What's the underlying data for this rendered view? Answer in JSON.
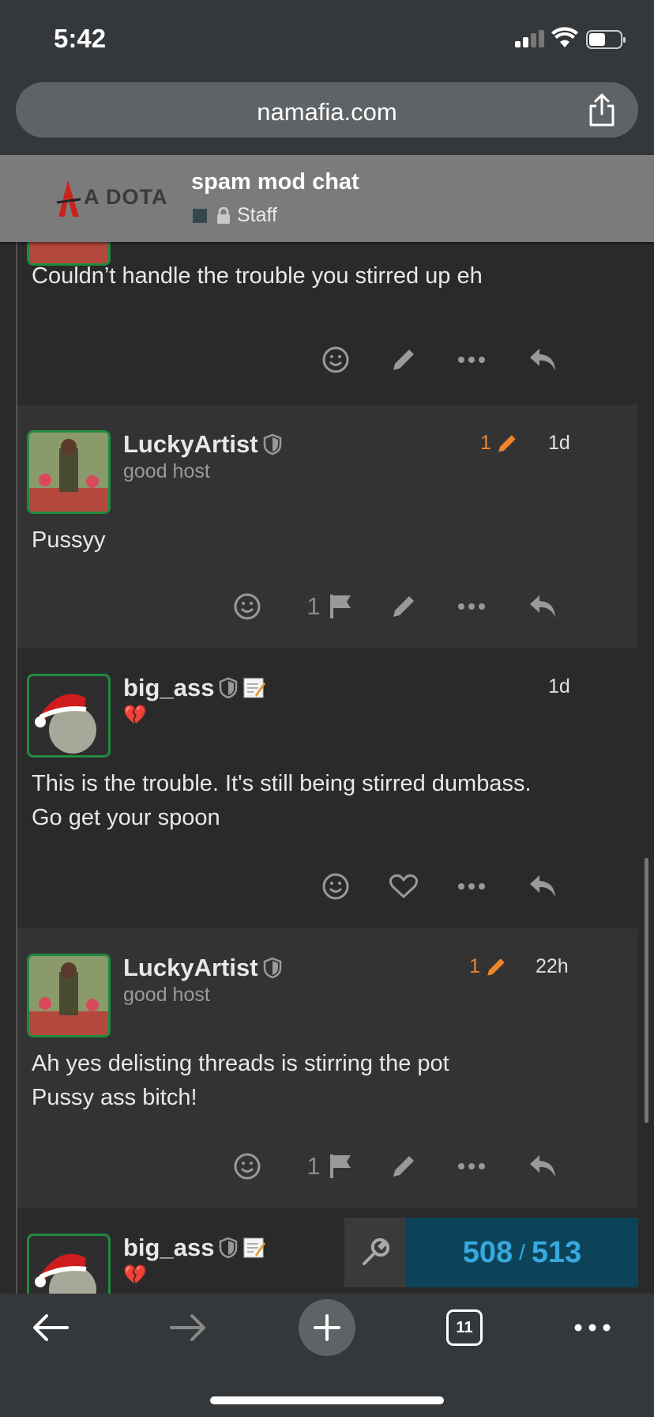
{
  "status": {
    "time": "5:42"
  },
  "browser": {
    "url": "namafia.com",
    "tab_count": "11"
  },
  "header": {
    "logo_text": "A DOTA",
    "topic_title": "spam mod chat",
    "category": "Staff"
  },
  "posts": [
    {
      "body_lines": [
        "Couldn’t handle the trouble you stirred up eh"
      ]
    },
    {
      "username": "LuckyArtist",
      "user_title": "good host",
      "edit_count": "1",
      "date": "1d",
      "body_lines": [
        "Pussyy"
      ],
      "flag_count": "1"
    },
    {
      "username": "big_ass",
      "flair": "💔",
      "date": "1d",
      "body_lines": [
        "This is the trouble. It's still being stirred dumbass.",
        "Go get your spoon"
      ]
    },
    {
      "username": "LuckyArtist",
      "user_title": "good host",
      "edit_count": "1",
      "date": "22h",
      "body_lines": [
        "Ah yes delisting threads is stirring the pot",
        "Pussy ass bitch!"
      ],
      "flag_count": "1"
    },
    {
      "username": "big_ass",
      "flair": "💔"
    }
  ],
  "progress": {
    "current": "508",
    "separator": "/",
    "total": "513"
  },
  "colors": {
    "accent_orange": "#f0842c",
    "progress_blue": "#36a9e1",
    "avatar_border": "#1f8a3e"
  }
}
